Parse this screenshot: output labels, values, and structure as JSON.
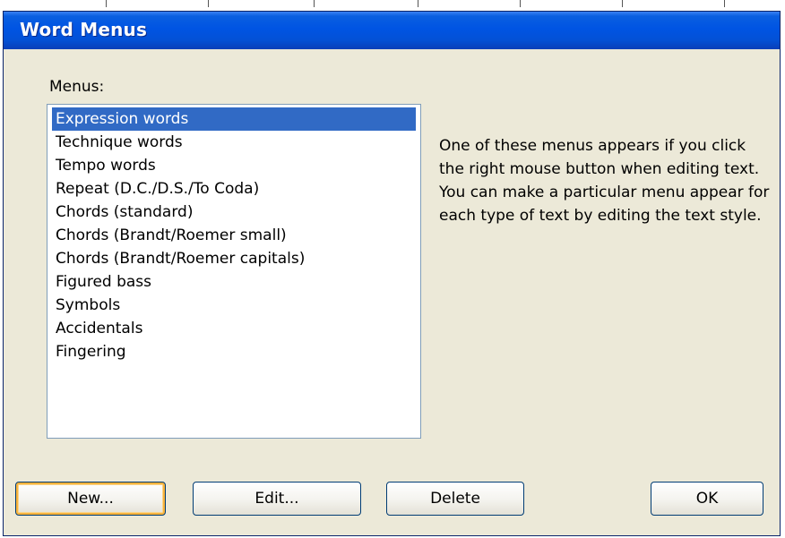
{
  "window": {
    "title": "Word Menus"
  },
  "menus": {
    "label": "Menus:",
    "items": [
      "Expression words",
      "Technique words",
      "Tempo words",
      "Repeat (D.C./D.S./To Coda)",
      "Chords (standard)",
      "Chords (Brandt/Roemer small)",
      "Chords (Brandt/Roemer capitals)",
      "Figured bass",
      "Symbols",
      "Accidentals",
      "Fingering"
    ],
    "selected": "Expression words"
  },
  "description": "One of these menus appears if you click the right mouse button when editing text. You can make a particular menu appear for each type of text by editing the text style.",
  "buttons": {
    "new_label": "New...",
    "edit_label": "Edit...",
    "delete_label": "Delete",
    "ok_label": "OK"
  },
  "colors": {
    "titlebar": "#0054e3",
    "selection": "#316ac5",
    "dialog_background": "#ece9d8",
    "default_button_highlight": "#f8b33c"
  }
}
